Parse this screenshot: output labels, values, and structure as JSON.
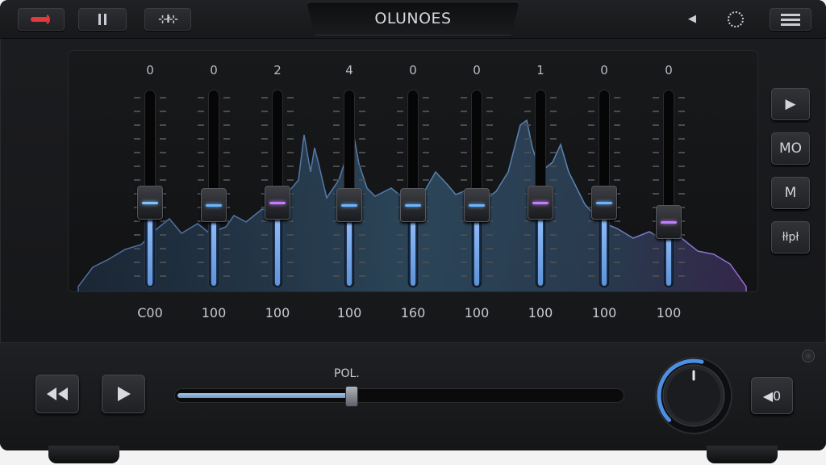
{
  "header": {
    "title": "OLUNOES",
    "icons": [
      "power-icon",
      "pause-icon",
      "equalizer-icon",
      "back-arrow-icon",
      "settings-icon",
      "menu-icon"
    ],
    "eq_button_label": "⊹ł⊹"
  },
  "equalizer": {
    "bands": [
      {
        "value": "0",
        "freq": "C00",
        "level": 0.43,
        "accent": "#7fc4ff"
      },
      {
        "value": "0",
        "freq": "100",
        "level": 0.42,
        "accent": "#6bb5ff"
      },
      {
        "value": "2",
        "freq": "100",
        "level": 0.43,
        "accent": "#c27cff"
      },
      {
        "value": "4",
        "freq": "100",
        "level": 0.42,
        "accent": "#6bb5ff"
      },
      {
        "value": "0",
        "freq": "160",
        "level": 0.42,
        "accent": "#6bb5ff"
      },
      {
        "value": "0",
        "freq": "100",
        "level": 0.42,
        "accent": "#6bb5ff"
      },
      {
        "value": "1",
        "freq": "100",
        "level": 0.43,
        "accent": "#c27cff"
      },
      {
        "value": "0",
        "freq": "100",
        "level": 0.43,
        "accent": "#6bb5ff"
      },
      {
        "value": "0",
        "freq": "100",
        "level": 0.33,
        "accent": "#c27cff"
      }
    ]
  },
  "side_buttons": {
    "play_icon": "▶",
    "mono": "MO",
    "mute": "M",
    "misc": "łłpł"
  },
  "transport": {
    "rewind_icon": "rewind-icon",
    "play_icon": "play-icon",
    "position_label": "POL.",
    "position": 0.39,
    "volume_level": 0.55,
    "volume_button": "◀0"
  },
  "colors": {
    "accent_blue": "#5d93d8",
    "accent_purple": "#a56cff",
    "panel_bg": "#141517"
  }
}
